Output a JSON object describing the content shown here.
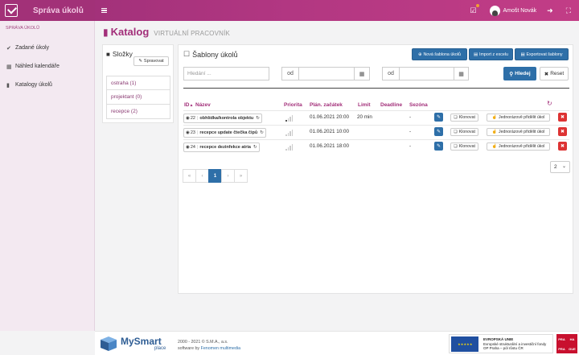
{
  "app": {
    "title": "Správa úkolů"
  },
  "user": {
    "name": "Amošt Novák"
  },
  "sidebar": {
    "heading": "SPRÁVA ÚKOLŮ",
    "items": [
      {
        "label": "Zadané úkoly",
        "icon": "check-circle-icon"
      },
      {
        "label": "Náhled kalendáře",
        "icon": "calendar-icon"
      },
      {
        "label": "Katalogy úkolů",
        "icon": "book-icon"
      }
    ]
  },
  "page": {
    "title": "Katalog",
    "subtitle": "VIRTUÁLNÍ PRACOVNÍK"
  },
  "folders": {
    "title": "Složky",
    "manage_label": "Spravovat",
    "items": [
      {
        "label": "ostraha (1)"
      },
      {
        "label": "projektant (0)"
      },
      {
        "label": "recepce (2)"
      }
    ]
  },
  "templates": {
    "title": "Šablony úkolů",
    "buttons": {
      "new": "Nová šablona úkolů",
      "import": "Import z excelu",
      "export": "Exportovat šablony"
    },
    "search": {
      "placeholder": "Hledání ...",
      "from_label_1": "od",
      "from_label_2": "od",
      "search_label": "Hledej",
      "reset_label": "Reset"
    },
    "columns": {
      "id": "ID",
      "name": "Název",
      "priority": "Priorita",
      "planned_start": "Plán. začátek",
      "limit": "Limit",
      "deadline": "Deadline",
      "season": "Sezóna"
    },
    "rows": [
      {
        "id": "22",
        "name": "obhlídka/kontrola objektu",
        "priority": 1,
        "planned_start": "01.06.2021 20:00",
        "limit": "20 min",
        "season": "-",
        "clone": "Klonovat",
        "assign": "Jednorázově přidělit úkol"
      },
      {
        "id": "23",
        "name": "recepce update čtečka čipů",
        "priority": 0,
        "planned_start": "01.06.2021 10:00",
        "limit": "",
        "season": "-",
        "clone": "Klonovat",
        "assign": "Jednorázově přidělit úkol"
      },
      {
        "id": "24",
        "name": "recepce dezinfekce atria",
        "priority": 0,
        "planned_start": "01.06.2021 18:00",
        "limit": "",
        "season": "-",
        "clone": "Klonovat",
        "assign": "Jednorázově přidělit úkol"
      }
    ],
    "pagination": {
      "first": "«",
      "prev": "‹",
      "current": "1",
      "next": "›",
      "last": "»"
    },
    "per_page": "2"
  },
  "footer": {
    "brand": "MySmart",
    "brand_sub": "place",
    "copyright": "2000 - 2021 © S.M.A., a.s.",
    "software_by": "software by",
    "vendor": "Fenomen multimedia",
    "eu_flag_text": "★ ★ ★ ★ ★",
    "eu_line1": "EVROPSKÁ UNIE",
    "eu_line2": "Evropské strukturální a investiční fondy",
    "eu_line3": "OP Praha – pól růstu ČR",
    "praha": [
      "PRA",
      "HA",
      "PRA",
      "GUE"
    ]
  }
}
